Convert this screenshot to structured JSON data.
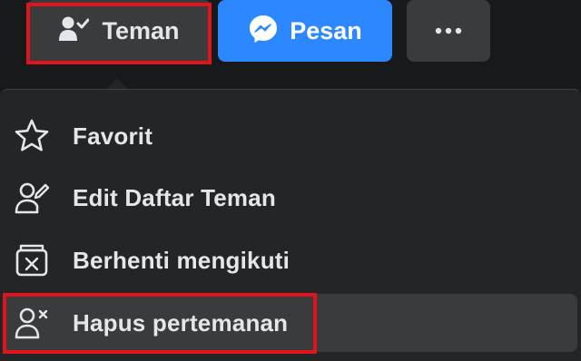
{
  "actions": {
    "friends_label": "Teman",
    "message_label": "Pesan",
    "more_label": "•••"
  },
  "menu": {
    "items": [
      {
        "label": "Favorit",
        "icon": "star-icon"
      },
      {
        "label": "Edit Daftar Teman",
        "icon": "edit-friend-list-icon"
      },
      {
        "label": "Berhenti mengikuti",
        "icon": "unfollow-icon"
      },
      {
        "label": "Hapus pertemanan",
        "icon": "unfriend-icon"
      }
    ]
  },
  "colors": {
    "background": "#18191a",
    "menu_bg": "#242526",
    "button_gray": "#3a3b3c",
    "button_blue": "#2d88ff",
    "highlight_red": "#e0151b",
    "text": "#e4e6eb"
  }
}
